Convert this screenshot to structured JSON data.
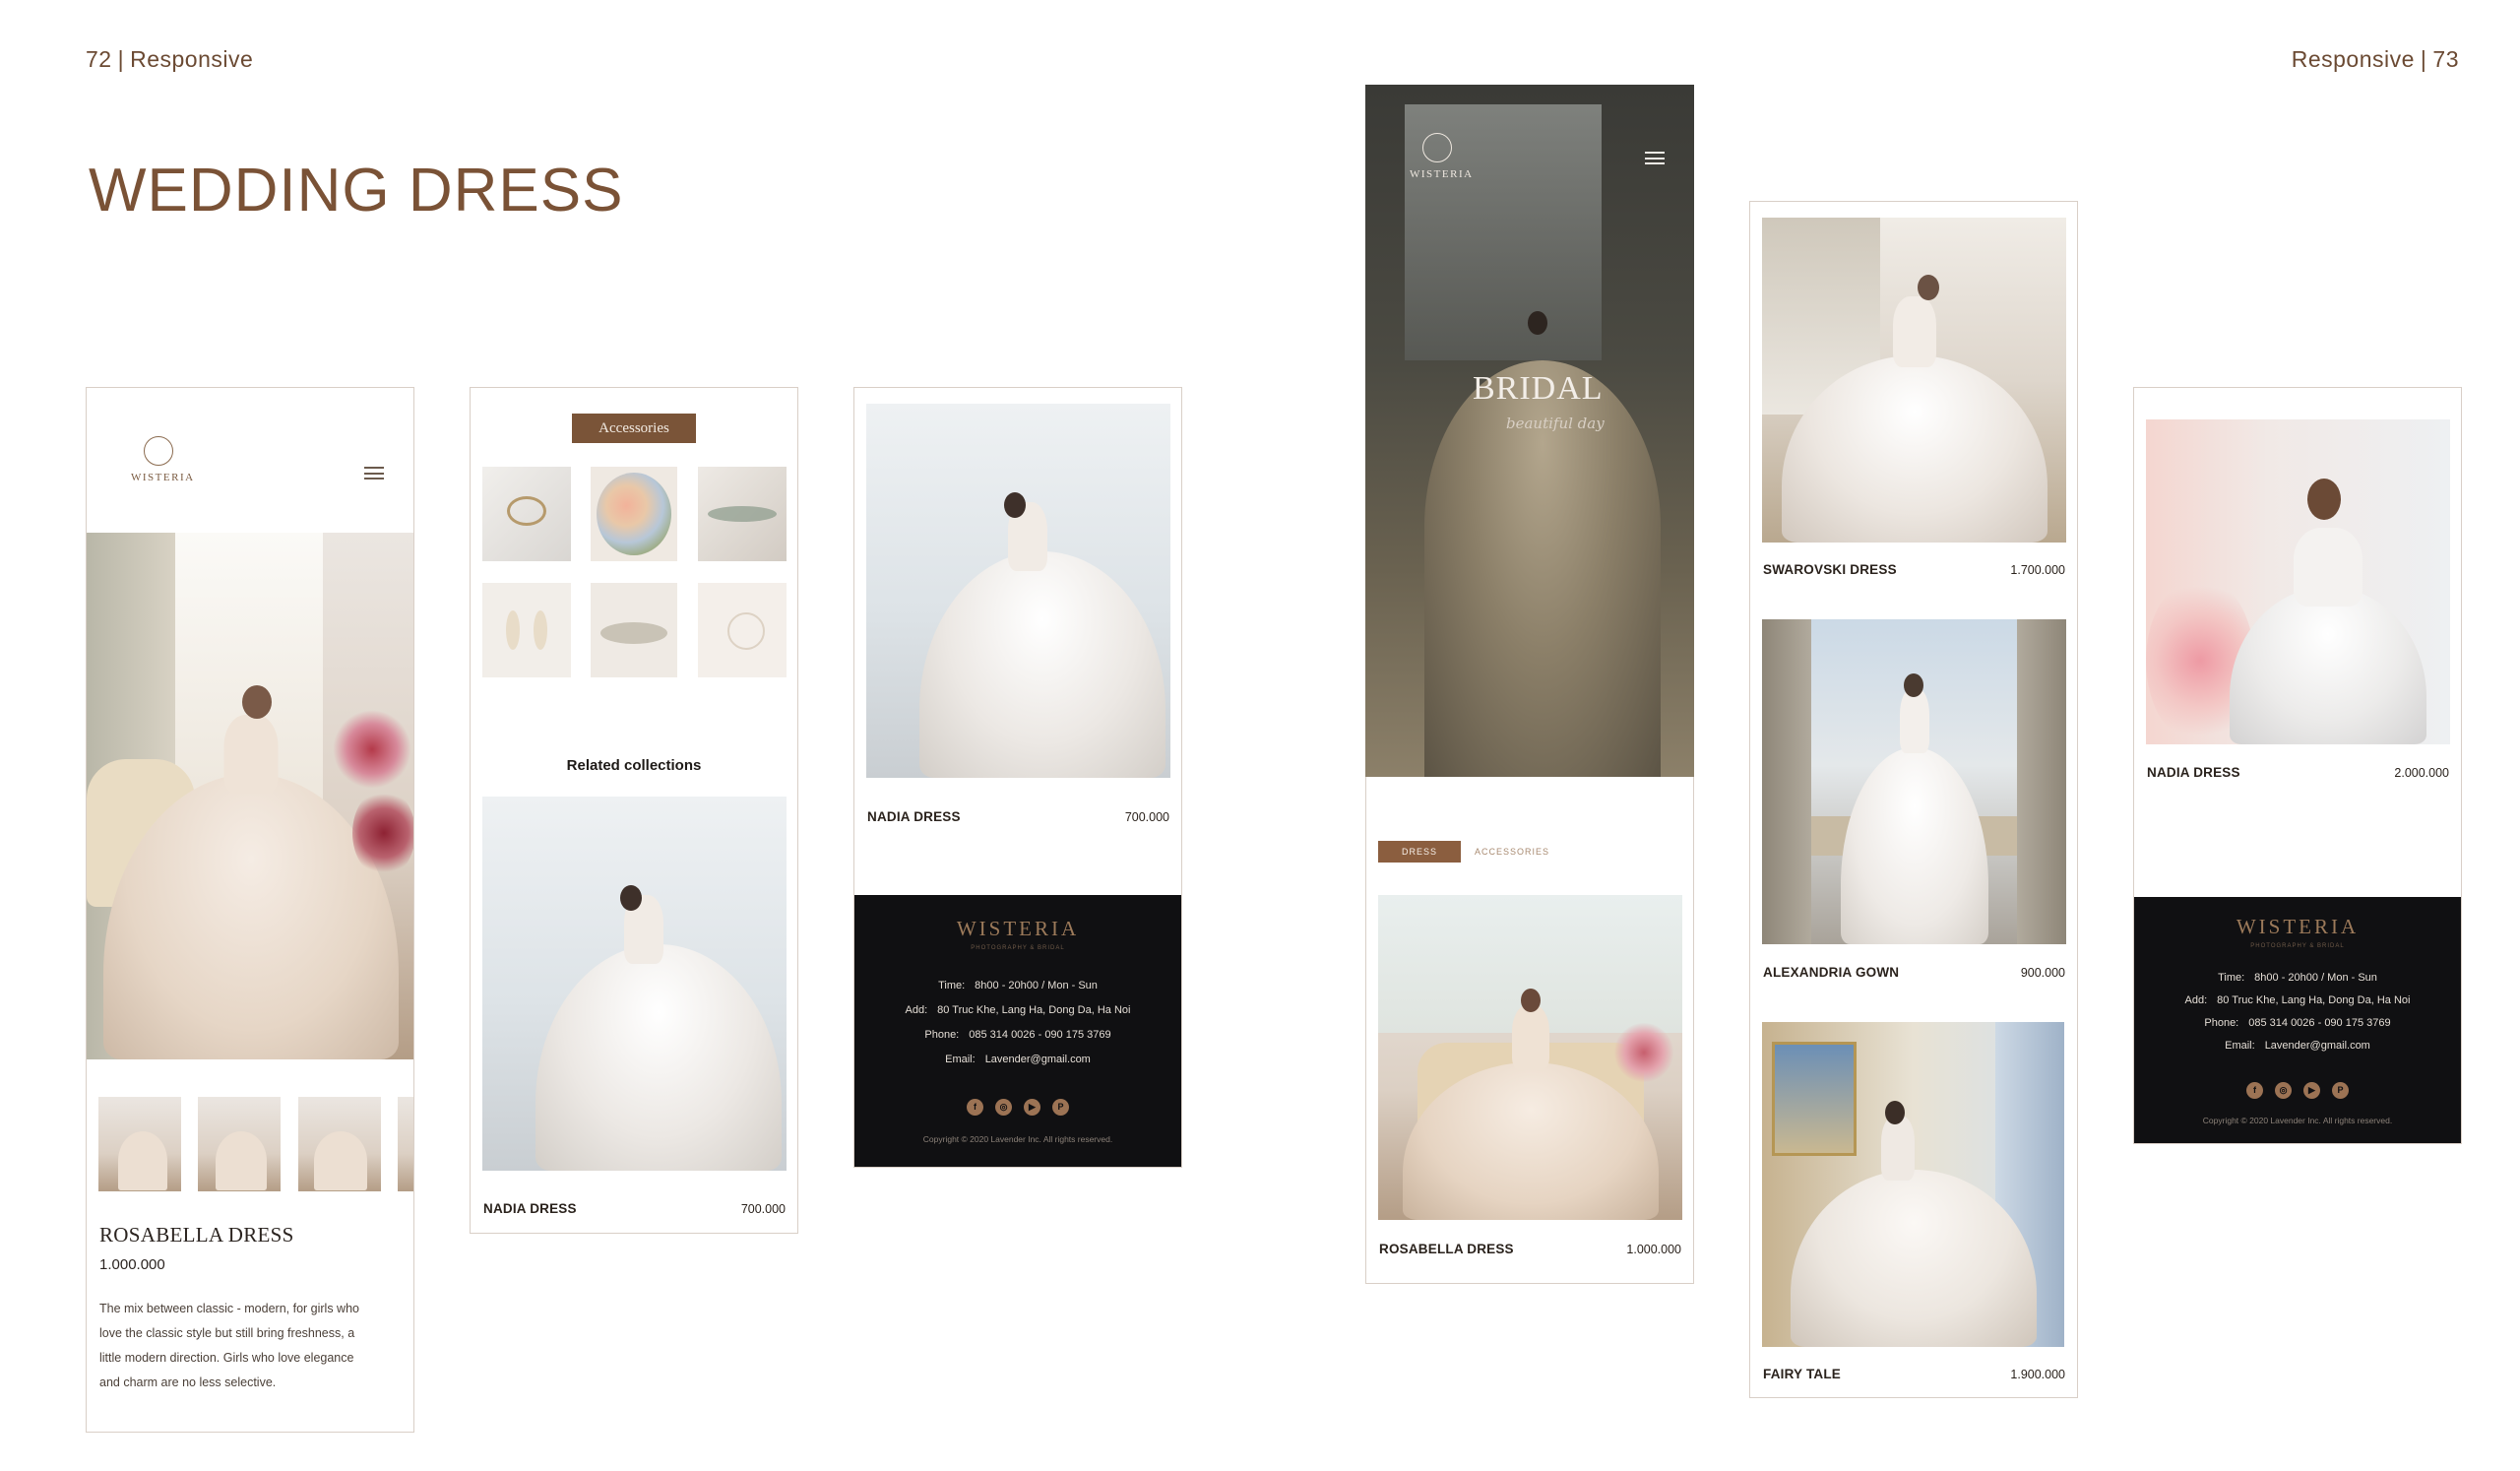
{
  "header": {
    "left_page_number": "72",
    "left_section": "Responsive",
    "right_section": "Responsive",
    "right_page_number": "73",
    "title": "WEDDING DRESS"
  },
  "brand": {
    "logo_text": "WISTERIA",
    "footer_name": "WISTERIA",
    "footer_tagline": "PHOTOGRAPHY & BRIDAL"
  },
  "screen1": {
    "product_title": "ROSABELLA DRESS",
    "price": "1.000.000",
    "description_lines": [
      "The mix between classic - modern, for girls who",
      "love the classic style but still bring freshness, a",
      "little modern direction. Girls who love elegance",
      "and charm are no less selective."
    ]
  },
  "screen2": {
    "accessories_label": "Accessories",
    "related_label": "Related collections",
    "product_name": "NADIA DRESS",
    "product_price": "700.000"
  },
  "screen3": {
    "product_name": "NADIA DRESS",
    "product_price": "700.000"
  },
  "footer": {
    "time_label": "Time:",
    "time_value": "8h00 - 20h00  /  Mon - Sun",
    "add_label": "Add:",
    "add_value": "80 Truc Khe, Lang Ha, Dong Da, Ha Noi",
    "phone_label": "Phone:",
    "phone_value": "085 314 0026  -  090 175 3769",
    "email_label": "Email:",
    "email_value": "Lavender@gmail.com",
    "social_icons": [
      "facebook-icon",
      "instagram-icon",
      "youtube-icon",
      "pinterest-icon"
    ],
    "copyright": "Copyright © 2020 Lavender Inc. All rights reserved."
  },
  "screen4": {
    "hero_title": "BRIDAL",
    "hero_script": "beautiful day",
    "tab_dress": "DRESS",
    "tab_accessories": "ACCESSORIES",
    "product_name": "ROSABELLA DRESS",
    "product_price": "1.000.000"
  },
  "screen5": {
    "products": [
      {
        "name": "SWAROVSKI DRESS",
        "price": "1.700.000"
      },
      {
        "name": "ALEXANDRIA GOWN",
        "price": "900.000"
      },
      {
        "name": "FAIRY TALE",
        "price": "1.900.000"
      }
    ]
  },
  "screen6": {
    "product_name": "NADIA DRESS",
    "product_price": "2.000.000"
  },
  "colors": {
    "brand_brown": "#7a5438",
    "title_brown": "#7a5236",
    "footer_black": "#101012"
  }
}
